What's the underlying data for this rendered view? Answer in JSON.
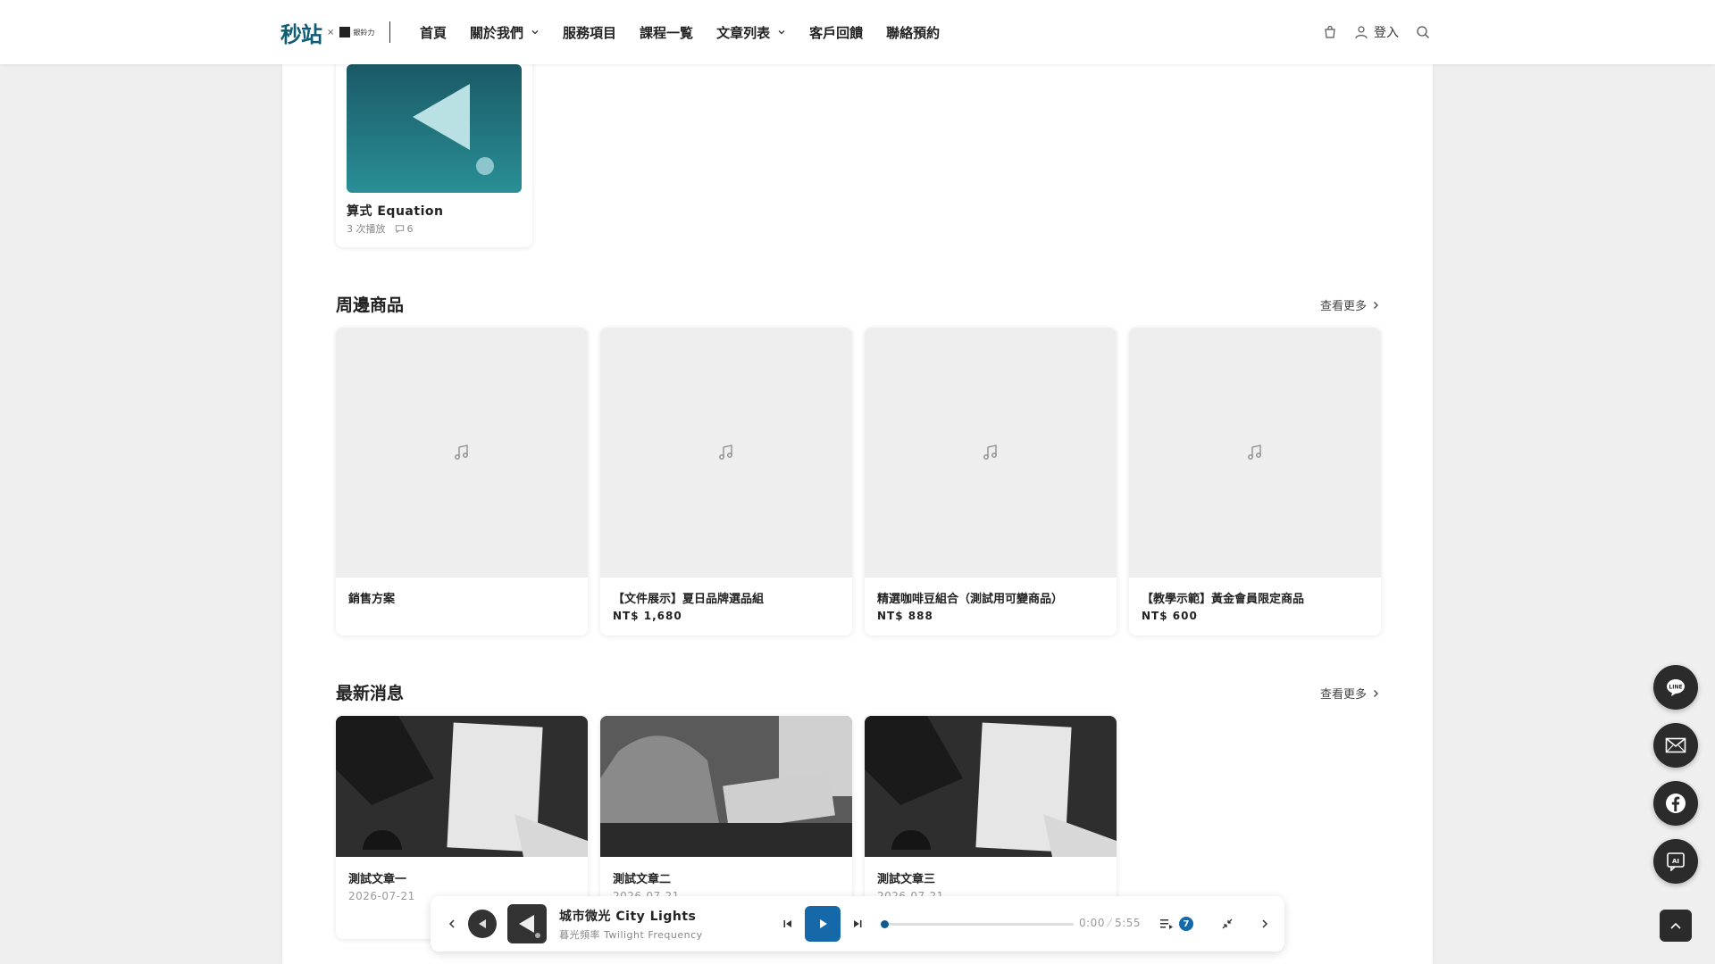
{
  "header": {
    "logo_main": "秒站",
    "logo_x": "×",
    "logo_partner": "銀鈴力",
    "nav": [
      {
        "label": "首頁"
      },
      {
        "label": "關於我們"
      },
      {
        "label": "服務項目"
      },
      {
        "label": "課程一覧"
      },
      {
        "label": "文章列表"
      },
      {
        "label": "客戶回饋"
      },
      {
        "label": "聯絡預約"
      }
    ],
    "login": "登入"
  },
  "album": {
    "title": "算式 Equation",
    "plays": "3 次播放",
    "comments": "6"
  },
  "products_section": {
    "title": "周邊商品",
    "see_more": "查看更多",
    "items": [
      {
        "name": "銷售方案",
        "price": ""
      },
      {
        "name": "【文件展示】夏日品牌選品組",
        "price": "NT$ 1,680"
      },
      {
        "name": "精選咖啡豆組合（測試用可變商品）",
        "price": "NT$ 888"
      },
      {
        "name": "【教學示範】黃金會員限定商品",
        "price": "NT$ 600"
      }
    ]
  },
  "news_section": {
    "title": "最新消息",
    "see_more": "查看更多",
    "items": [
      {
        "title": "測試文章一",
        "date": "2026-07-21"
      },
      {
        "title": "測試文章二",
        "date": "2026-07-21"
      },
      {
        "title": "測試文章三",
        "date": "2026-07-21"
      }
    ]
  },
  "player": {
    "title": "城市微光 City Lights",
    "artist": "暮光頻率 Twilight Frequency",
    "current_time": "0:00",
    "duration": "5:55",
    "queue_count": "7",
    "progress": 0.0
  },
  "colors": {
    "accent": "#1569a8",
    "dark_button": "#2b2b2b",
    "logo": "#0f5d75"
  }
}
